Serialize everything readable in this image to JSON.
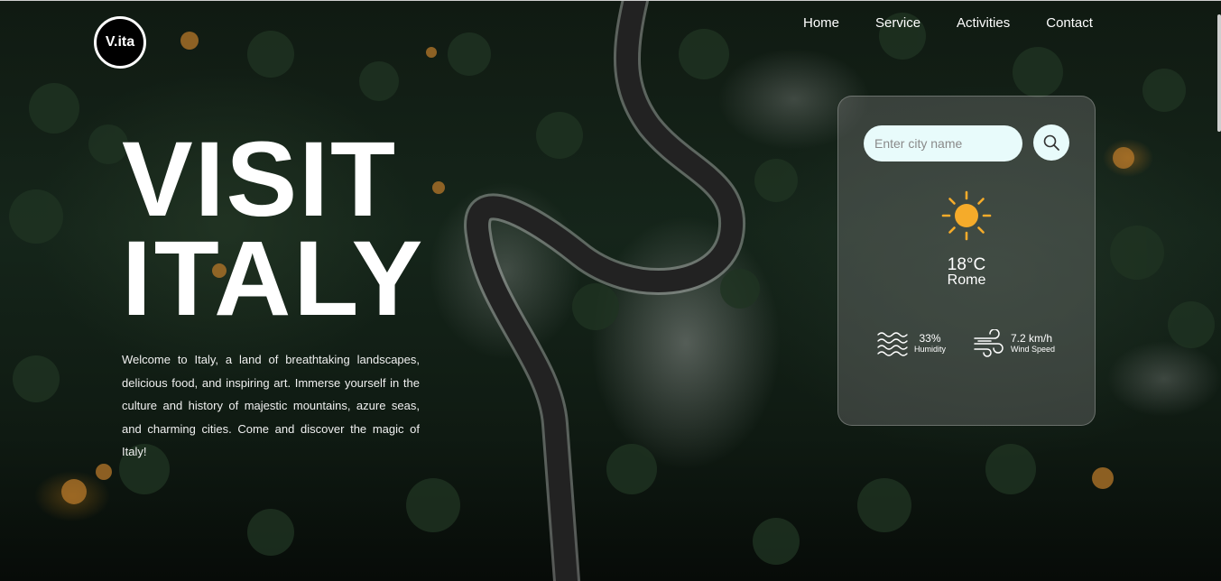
{
  "logo": {
    "text": "V.ita"
  },
  "nav": {
    "items": [
      {
        "label": "Home"
      },
      {
        "label": "Service"
      },
      {
        "label": "Activities"
      },
      {
        "label": "Contact"
      }
    ]
  },
  "hero": {
    "line1": "VISIT",
    "line2": "ITALY",
    "description": "Welcome to Italy, a land of breathtaking landscapes, delicious food, and inspiring art. Immerse yourself in the culture and history of majestic mountains, azure seas, and charming cities. Come and discover the magic of Italy!"
  },
  "weather": {
    "search_placeholder": "Enter city name",
    "search_value": "",
    "icon": "sun-icon",
    "temperature": "18°C",
    "city": "Rome",
    "humidity_value": "33%",
    "humidity_label": "Humidity",
    "wind_value": "7.2 km/h",
    "wind_label": "Wind Speed"
  },
  "colors": {
    "sun": "#f5ab2a",
    "input_bg": "#e8fbfb",
    "card_bg": "rgba(120,120,120,0.38)"
  }
}
